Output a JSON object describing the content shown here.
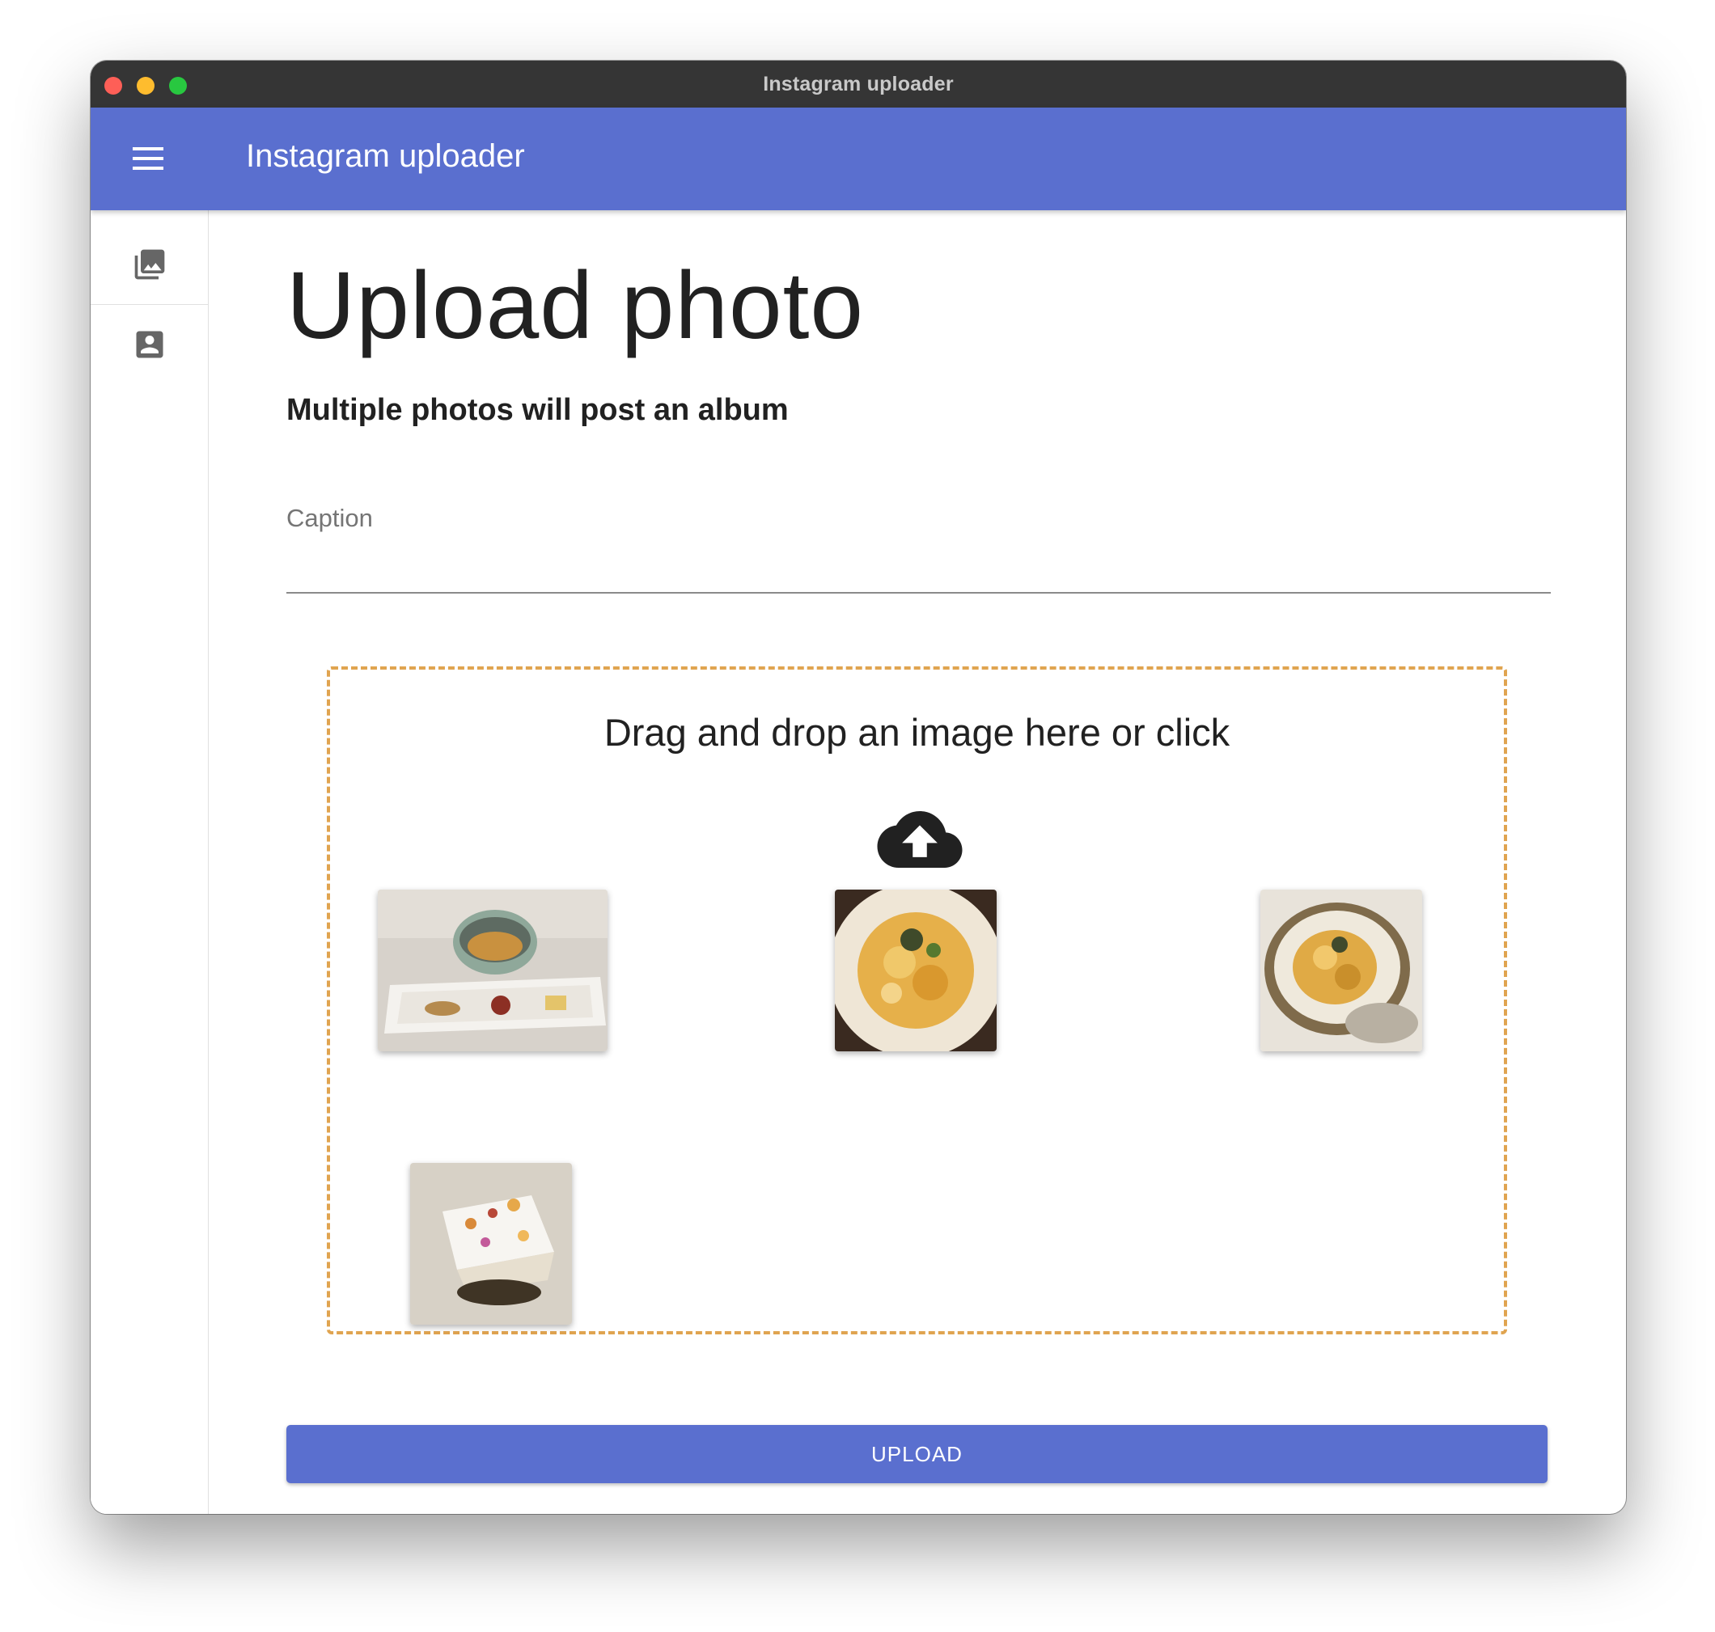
{
  "window": {
    "title": "Instagram uploader"
  },
  "appbar": {
    "title": "Instagram uploader",
    "menu_icon": "hamburger-menu-icon"
  },
  "sidebar": {
    "items": [
      {
        "icon": "photo-library-icon"
      },
      {
        "icon": "account-box-icon"
      }
    ]
  },
  "main": {
    "title": "Upload photo",
    "subtitle": "Multiple photos will post an album",
    "caption": {
      "label": "Caption",
      "value": ""
    },
    "dropzone": {
      "text": "Drag and drop an image here or click",
      "icon": "cloud-upload-icon",
      "previews": [
        {
          "icon": "photo-thumbnail-1"
        },
        {
          "icon": "photo-thumbnail-2"
        },
        {
          "icon": "photo-thumbnail-3"
        },
        {
          "icon": "photo-thumbnail-4"
        }
      ]
    },
    "upload_button": "UPLOAD"
  },
  "colors": {
    "appbar": "#5a6fcf",
    "titlebar": "#353535",
    "dropzone_border": "#e0a450",
    "button": "#5a6fcf"
  }
}
